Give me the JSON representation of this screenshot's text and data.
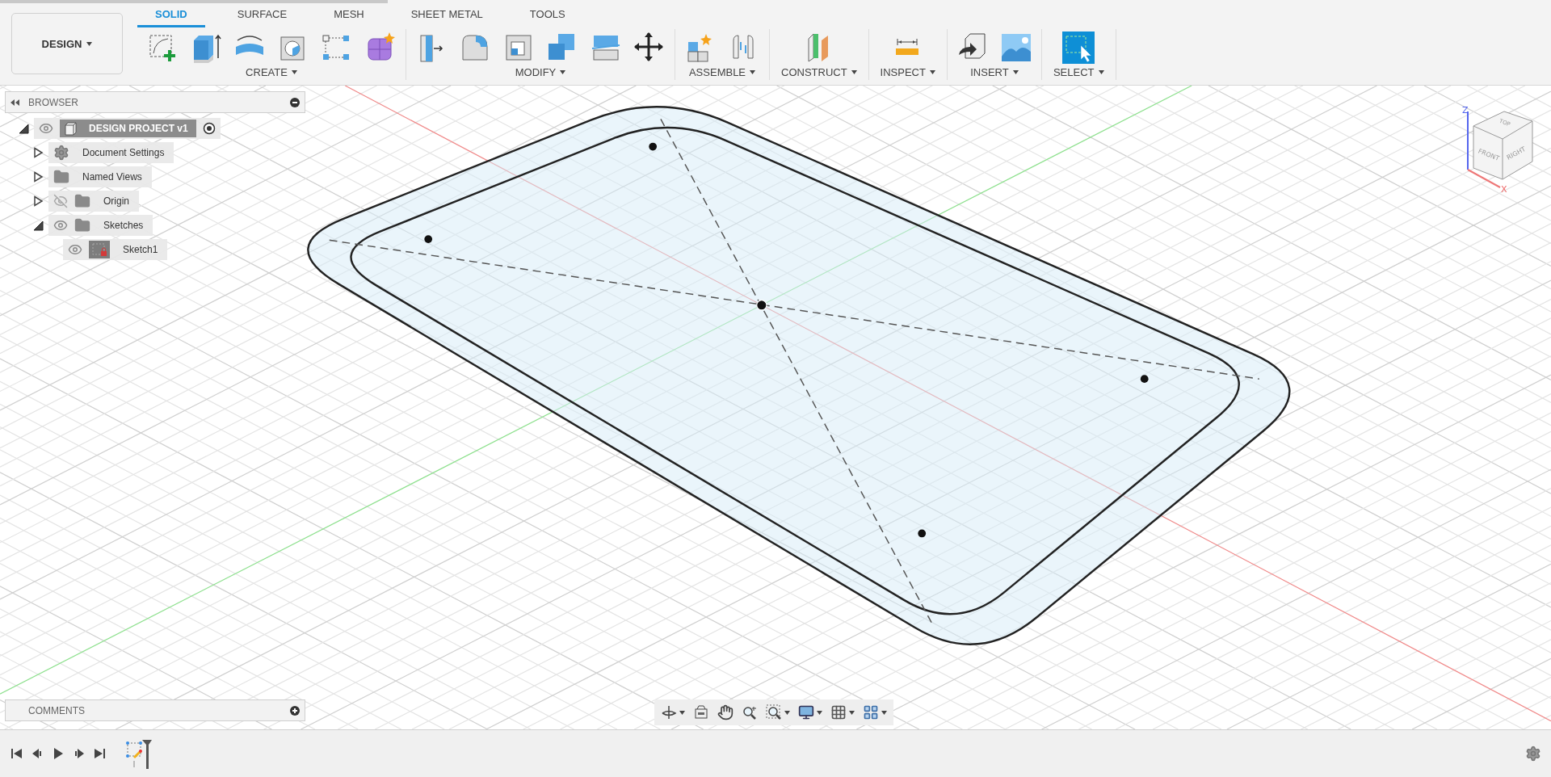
{
  "toolbar": {
    "workspace": "DESIGN",
    "tabs": [
      {
        "label": "SOLID",
        "selected": true
      },
      {
        "label": "SURFACE",
        "selected": false
      },
      {
        "label": "MESH",
        "selected": false
      },
      {
        "label": "SHEET METAL",
        "selected": false
      },
      {
        "label": "TOOLS",
        "selected": false
      }
    ],
    "groups": [
      {
        "label": "CREATE",
        "kind": "create"
      },
      {
        "label": "MODIFY",
        "kind": "modify"
      },
      {
        "label": "ASSEMBLE",
        "kind": "assemble"
      },
      {
        "label": "CONSTRUCT",
        "kind": "construct"
      },
      {
        "label": "INSPECT",
        "kind": "inspect"
      },
      {
        "label": "INSERT",
        "kind": "insert"
      },
      {
        "label": "SELECT",
        "kind": "select"
      }
    ]
  },
  "browser": {
    "title": "BROWSER",
    "root": {
      "label": "DESIGN PROJECT v1",
      "expanded": true,
      "visible": true,
      "active": true,
      "children": [
        {
          "label": "Document Settings",
          "kind": "settings",
          "expanded": false
        },
        {
          "label": "Named Views",
          "kind": "folder",
          "expanded": false
        },
        {
          "label": "Origin",
          "kind": "folder",
          "expanded": false,
          "visible": false
        },
        {
          "label": "Sketches",
          "kind": "folder",
          "expanded": true,
          "visible": true,
          "children": [
            {
              "label": "Sketch1",
              "kind": "sketch",
              "visible": true
            }
          ]
        }
      ]
    }
  },
  "viewcube": {
    "faces": [
      "TOP",
      "FRONT",
      "RIGHT"
    ],
    "axes": [
      "Z",
      "X"
    ]
  },
  "comments": {
    "title": "COMMENTS"
  }
}
